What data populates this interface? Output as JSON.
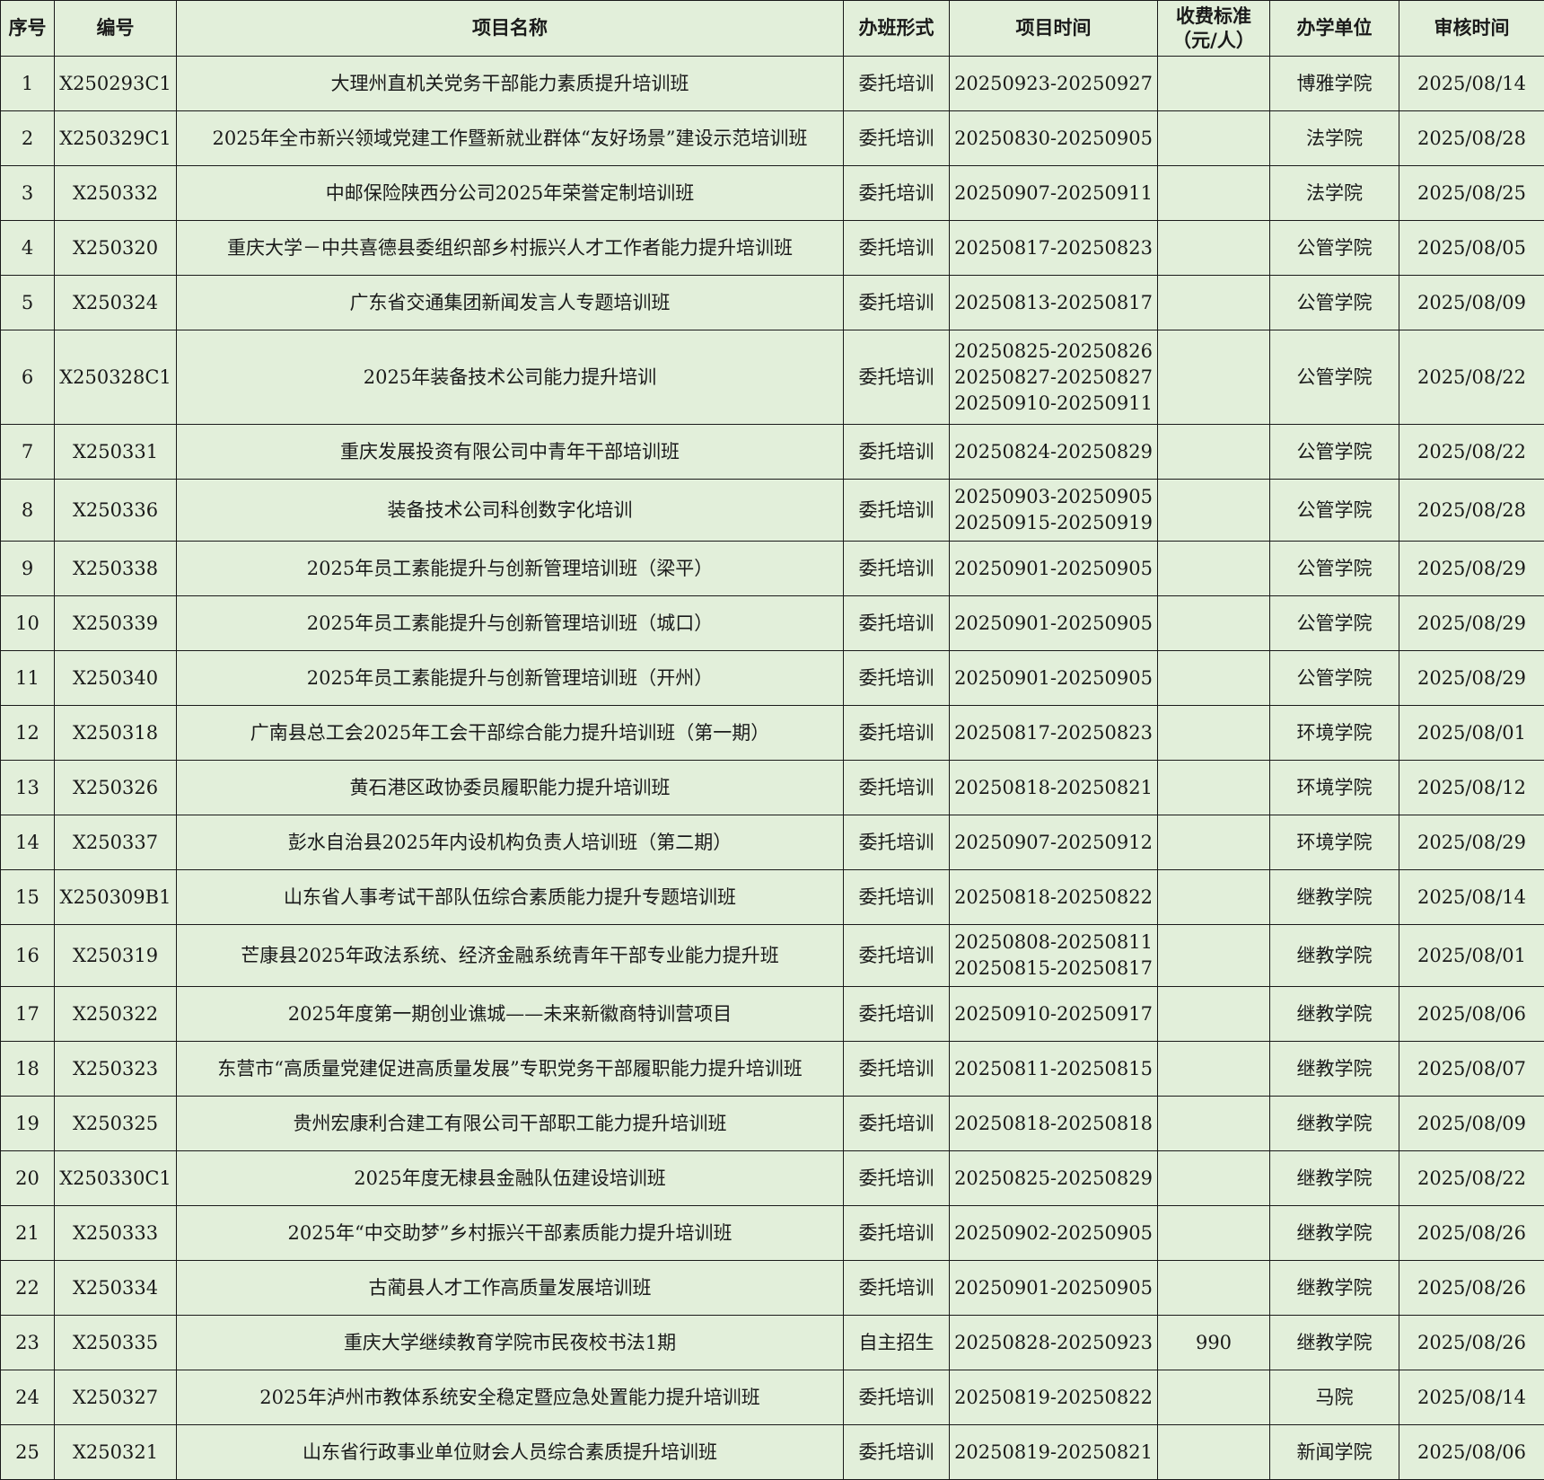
{
  "headers": {
    "seq": "序号",
    "code": "编号",
    "name": "项目名称",
    "form": "办班形式",
    "time": "项目时间",
    "fee": "收费标准（元/人）",
    "unit": "办学单位",
    "review": "审核时间"
  },
  "rows": [
    {
      "seq": "1",
      "code": "X250293C1",
      "name": "大理州直机关党务干部能力素质提升培训班",
      "form": "委托培训",
      "time": [
        "20250923-20250927"
      ],
      "fee": "",
      "unit": "博雅学院",
      "review": "2025/08/14"
    },
    {
      "seq": "2",
      "code": "X250329C1",
      "name": "2025年全市新兴领域党建工作暨新就业群体“友好场景”建设示范培训班",
      "form": "委托培训",
      "time": [
        "20250830-20250905"
      ],
      "fee": "",
      "unit": "法学院",
      "review": "2025/08/28"
    },
    {
      "seq": "3",
      "code": "X250332",
      "name": "中邮保险陕西分公司2025年荣誉定制培训班",
      "form": "委托培训",
      "time": [
        "20250907-20250911"
      ],
      "fee": "",
      "unit": "法学院",
      "review": "2025/08/25"
    },
    {
      "seq": "4",
      "code": "X250320",
      "name": "重庆大学－中共喜德县委组织部乡村振兴人才工作者能力提升培训班",
      "form": "委托培训",
      "time": [
        "20250817-20250823"
      ],
      "fee": "",
      "unit": "公管学院",
      "review": "2025/08/05"
    },
    {
      "seq": "5",
      "code": "X250324",
      "name": "广东省交通集团新闻发言人专题培训班",
      "form": "委托培训",
      "time": [
        "20250813-20250817"
      ],
      "fee": "",
      "unit": "公管学院",
      "review": "2025/08/09"
    },
    {
      "seq": "6",
      "code": "X250328C1",
      "name": "2025年装备技术公司能力提升培训",
      "form": "委托培训",
      "time": [
        "20250825-20250826",
        "20250827-20250827",
        "20250910-20250911"
      ],
      "fee": "",
      "unit": "公管学院",
      "review": "2025/08/22"
    },
    {
      "seq": "7",
      "code": "X250331",
      "name": "重庆发展投资有限公司中青年干部培训班",
      "form": "委托培训",
      "time": [
        "20250824-20250829"
      ],
      "fee": "",
      "unit": "公管学院",
      "review": "2025/08/22"
    },
    {
      "seq": "8",
      "code": "X250336",
      "name": "装备技术公司科创数字化培训",
      "form": "委托培训",
      "time": [
        "20250903-20250905",
        "20250915-20250919"
      ],
      "fee": "",
      "unit": "公管学院",
      "review": "2025/08/28"
    },
    {
      "seq": "9",
      "code": "X250338",
      "name": "2025年员工素能提升与创新管理培训班（梁平）",
      "form": "委托培训",
      "time": [
        "20250901-20250905"
      ],
      "fee": "",
      "unit": "公管学院",
      "review": "2025/08/29"
    },
    {
      "seq": "10",
      "code": "X250339",
      "name": "2025年员工素能提升与创新管理培训班（城口）",
      "form": "委托培训",
      "time": [
        "20250901-20250905"
      ],
      "fee": "",
      "unit": "公管学院",
      "review": "2025/08/29"
    },
    {
      "seq": "11",
      "code": "X250340",
      "name": "2025年员工素能提升与创新管理培训班（开州）",
      "form": "委托培训",
      "time": [
        "20250901-20250905"
      ],
      "fee": "",
      "unit": "公管学院",
      "review": "2025/08/29"
    },
    {
      "seq": "12",
      "code": "X250318",
      "name": "广南县总工会2025年工会干部综合能力提升培训班（第一期）",
      "form": "委托培训",
      "time": [
        "20250817-20250823"
      ],
      "fee": "",
      "unit": "环境学院",
      "review": "2025/08/01"
    },
    {
      "seq": "13",
      "code": "X250326",
      "name": "黄石港区政协委员履职能力提升培训班",
      "form": "委托培训",
      "time": [
        "20250818-20250821"
      ],
      "fee": "",
      "unit": "环境学院",
      "review": "2025/08/12"
    },
    {
      "seq": "14",
      "code": "X250337",
      "name": "彭水自治县2025年内设机构负责人培训班（第二期）",
      "form": "委托培训",
      "time": [
        "20250907-20250912"
      ],
      "fee": "",
      "unit": "环境学院",
      "review": "2025/08/29"
    },
    {
      "seq": "15",
      "code": "X250309B1",
      "name": "山东省人事考试干部队伍综合素质能力提升专题培训班",
      "form": "委托培训",
      "time": [
        "20250818-20250822"
      ],
      "fee": "",
      "unit": "继教学院",
      "review": "2025/08/14"
    },
    {
      "seq": "16",
      "code": "X250319",
      "name": "芒康县2025年政法系统、经济金融系统青年干部专业能力提升班",
      "form": "委托培训",
      "time": [
        "20250808-20250811",
        "20250815-20250817"
      ],
      "fee": "",
      "unit": "继教学院",
      "review": "2025/08/01"
    },
    {
      "seq": "17",
      "code": "X250322",
      "name": "2025年度第一期创业谯城——未来新徽商特训营项目",
      "form": "委托培训",
      "time": [
        "20250910-20250917"
      ],
      "fee": "",
      "unit": "继教学院",
      "review": "2025/08/06"
    },
    {
      "seq": "18",
      "code": "X250323",
      "name": "东营市“高质量党建促进高质量发展”专职党务干部履职能力提升培训班",
      "form": "委托培训",
      "time": [
        "20250811-20250815"
      ],
      "fee": "",
      "unit": "继教学院",
      "review": "2025/08/07"
    },
    {
      "seq": "19",
      "code": "X250325",
      "name": "贵州宏康利合建工有限公司干部职工能力提升培训班",
      "form": "委托培训",
      "time": [
        "20250818-20250818"
      ],
      "fee": "",
      "unit": "继教学院",
      "review": "2025/08/09"
    },
    {
      "seq": "20",
      "code": "X250330C1",
      "name": "2025年度无棣县金融队伍建设培训班",
      "form": "委托培训",
      "time": [
        "20250825-20250829"
      ],
      "fee": "",
      "unit": "继教学院",
      "review": "2025/08/22"
    },
    {
      "seq": "21",
      "code": "X250333",
      "name": "2025年“中交助梦”乡村振兴干部素质能力提升培训班",
      "form": "委托培训",
      "time": [
        "20250902-20250905"
      ],
      "fee": "",
      "unit": "继教学院",
      "review": "2025/08/26"
    },
    {
      "seq": "22",
      "code": "X250334",
      "name": "古蔺县人才工作高质量发展培训班",
      "form": "委托培训",
      "time": [
        "20250901-20250905"
      ],
      "fee": "",
      "unit": "继教学院",
      "review": "2025/08/26"
    },
    {
      "seq": "23",
      "code": "X250335",
      "name": "重庆大学继续教育学院市民夜校书法1期",
      "form": "自主招生",
      "time": [
        "20250828-20250923"
      ],
      "fee": "990",
      "unit": "继教学院",
      "review": "2025/08/26"
    },
    {
      "seq": "24",
      "code": "X250327",
      "name": "2025年泸州市教体系统安全稳定暨应急处置能力提升培训班",
      "form": "委托培训",
      "time": [
        "20250819-20250822"
      ],
      "fee": "",
      "unit": "马院",
      "review": "2025/08/14"
    },
    {
      "seq": "25",
      "code": "X250321",
      "name": "山东省行政事业单位财会人员综合素质提升培训班",
      "form": "委托培训",
      "time": [
        "20250819-20250821"
      ],
      "fee": "",
      "unit": "新闻学院",
      "review": "2025/08/06"
    }
  ]
}
